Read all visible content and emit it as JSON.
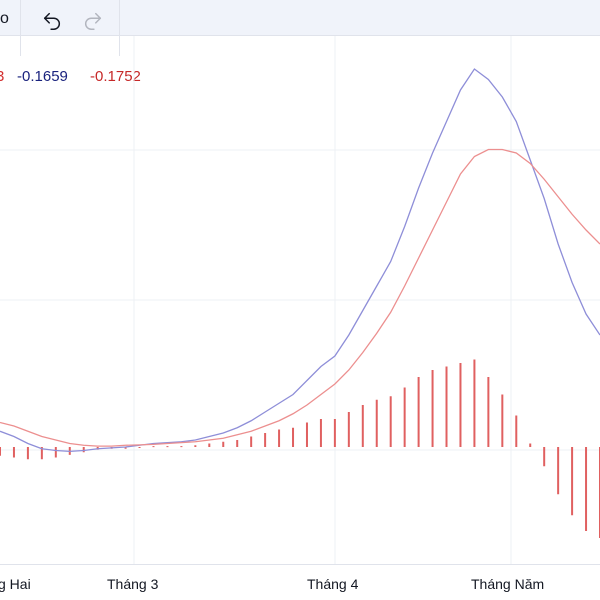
{
  "toolbar": {
    "partial_label": "o",
    "undo_icon": "undo-icon",
    "redo_icon": "redo-icon"
  },
  "legend": {
    "value_partial": "3",
    "macd": "-0.1659",
    "signal": "-0.1752"
  },
  "xaxis": {
    "labels": [
      "g Hai",
      "Tháng 3",
      "Tháng 4",
      "Tháng Năm"
    ]
  },
  "colors": {
    "macd_line": "#8e8ed8",
    "signal_line": "#ec8f8f",
    "histogram": "#e06060",
    "grid": "#eef0f4"
  },
  "chart_data": {
    "type": "line",
    "series": [
      {
        "values": [
          0.9,
          0.6,
          0.2,
          -0.1,
          -0.2,
          -0.25,
          -0.2,
          -0.1,
          -0.05,
          0.0,
          0.1,
          0.2,
          0.25,
          0.3,
          0.4,
          0.6,
          0.8,
          1.1,
          1.5,
          2.0,
          2.5,
          3.0,
          3.8,
          4.6,
          5.2,
          6.4,
          7.8,
          9.2,
          10.6,
          12.6,
          14.8,
          16.8,
          18.6,
          20.4,
          21.6,
          21.0,
          20.0,
          18.6,
          16.4,
          14.2,
          11.6,
          9.4,
          7.6,
          6.4
        ]
      },
      {
        "values": [
          1.4,
          1.2,
          0.9,
          0.6,
          0.4,
          0.2,
          0.1,
          0.05,
          0.05,
          0.1,
          0.12,
          0.15,
          0.2,
          0.25,
          0.3,
          0.4,
          0.5,
          0.7,
          0.9,
          1.2,
          1.5,
          1.9,
          2.4,
          3.0,
          3.6,
          4.4,
          5.4,
          6.5,
          7.7,
          9.2,
          10.8,
          12.4,
          14.0,
          15.6,
          16.6,
          17.0,
          17.0,
          16.8,
          16.2,
          15.3,
          14.3,
          13.3,
          12.4,
          11.6
        ]
      }
    ],
    "histogram": [
      -0.5,
      -0.6,
      -0.7,
      -0.7,
      -0.6,
      -0.45,
      -0.3,
      -0.15,
      -0.1,
      -0.1,
      -0.02,
      0.05,
      0.05,
      0.05,
      0.1,
      0.2,
      0.3,
      0.4,
      0.6,
      0.8,
      1.0,
      1.1,
      1.4,
      1.6,
      1.6,
      2.0,
      2.4,
      2.7,
      2.9,
      3.4,
      4.0,
      4.4,
      4.6,
      4.8,
      5.0,
      4.0,
      3.0,
      1.8,
      0.2,
      -1.1,
      -2.7,
      -3.9,
      -4.8,
      -5.2
    ]
  }
}
